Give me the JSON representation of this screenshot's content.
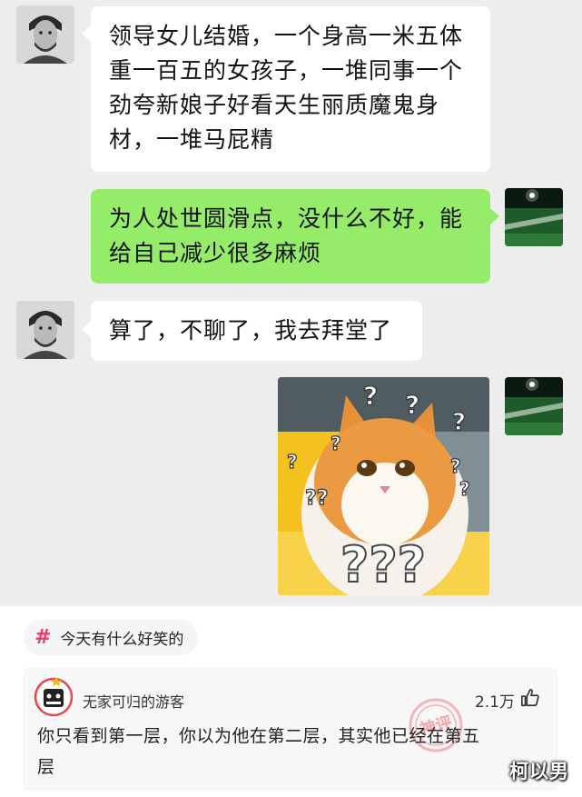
{
  "chat": {
    "messages": [
      {
        "side": "in",
        "lines": [
          "领导女儿结婚，一个身高一米五体",
          "重一百五的女孩子，一堆同事一个",
          "劲夸新娘子好看天生丽质魔鬼身",
          "材，一堆马屁精"
        ]
      },
      {
        "side": "out",
        "lines": [
          "为人处世圆滑点，没什么不好，能",
          "给自己减少很多麻烦"
        ]
      },
      {
        "side": "in",
        "lines": [
          "算了，不聊了，我去拜堂了"
        ]
      },
      {
        "side": "out",
        "type": "sticker",
        "sticker_text": "???"
      }
    ]
  },
  "topic": {
    "hashtag_icon": "#",
    "label": "今天有什么好笑的"
  },
  "comment": {
    "username": "无家可归的游客",
    "likes": "2.1万",
    "text_lines": [
      "你只看到第一层，你以为他在第二层，其实他已经在第五",
      "层"
    ],
    "stamp_text": "神评"
  },
  "watermark": "柯以男",
  "colors": {
    "chat_bg": "#ededed",
    "incoming_bubble": "#ffffff",
    "outgoing_bubble": "#95ec69",
    "hashtag": "#ee3c6a"
  }
}
